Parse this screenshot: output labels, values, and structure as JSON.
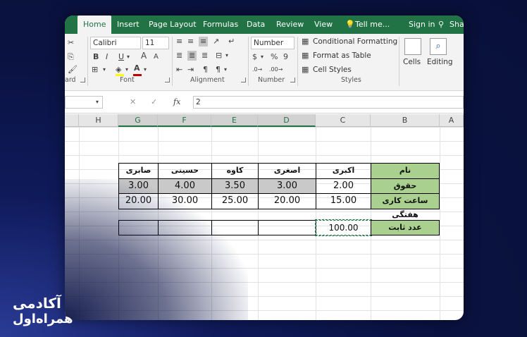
{
  "tabs": {
    "items": [
      "Home",
      "Insert",
      "Page Layout",
      "Formulas",
      "Data",
      "Review",
      "View"
    ],
    "tell_me": "Tell me...",
    "sign_in": "Sign in",
    "share": "Sha"
  },
  "ribbon": {
    "clipboard_label": "ard",
    "font": {
      "name": "Calibri",
      "size": "11",
      "bold": "B",
      "italic": "I",
      "underline": "U",
      "grow": "A",
      "shrink": "A",
      "label": "Font",
      "font_color": "#c00000"
    },
    "alignment_label": "Alignment",
    "number": {
      "format": "Number",
      "percent": "%",
      "comma": "9",
      "label": "Number"
    },
    "styles": {
      "conditional": "Conditional Formatting",
      "format_table": "Format as Table",
      "cell_styles": "Cell Styles",
      "label": "Styles"
    },
    "cells": "Cells",
    "editing": "Editing"
  },
  "formula_bar": {
    "fx": "fx",
    "value": "2"
  },
  "columns": [
    "H",
    "G",
    "F",
    "E",
    "D",
    "C",
    "B",
    "A"
  ],
  "sheet": {
    "header_label": "نام",
    "names": [
      "صابری",
      "حسینی",
      "کاوه",
      "اصغری",
      "اکبری"
    ],
    "row1_label": "حقوق",
    "row1": [
      "3.00",
      "4.00",
      "3.50",
      "3.00",
      "2.00"
    ],
    "row2_label": "ساعت کاری هفتگی",
    "row2": [
      "20.00",
      "30.00",
      "25.00",
      "20.00",
      "15.00"
    ],
    "const_label": "عدد ثابت",
    "const_value": "100.00"
  },
  "brand": {
    "line1": "آکادمی",
    "line2": "همراه‌اول"
  }
}
